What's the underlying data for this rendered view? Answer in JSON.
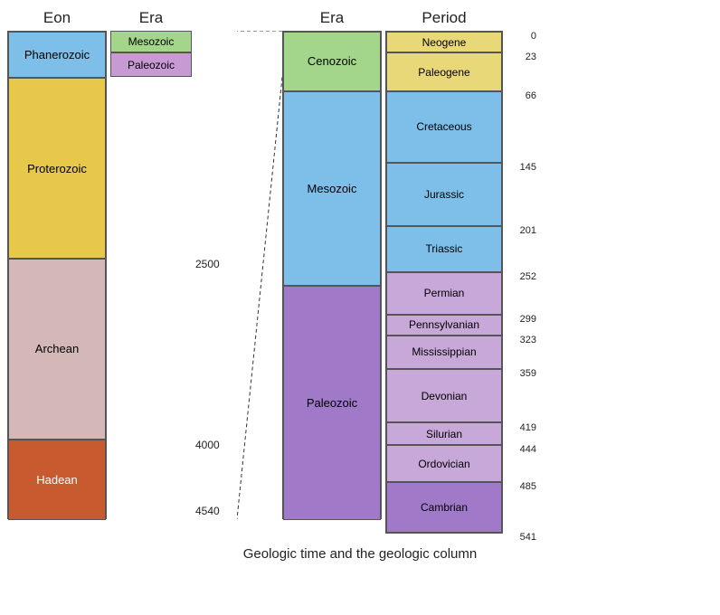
{
  "title": "Geologic time and the geologic column",
  "headers": {
    "eon": "Eon",
    "era_left": "Era",
    "era_right": "Era",
    "period": "Period"
  },
  "eons": [
    {
      "name": "Phanerozoic",
      "class": "cell-phanerozoic",
      "height_pct": 9.5
    },
    {
      "name": "Proterozoic",
      "class": "cell-proterozoic",
      "height_pct": 37
    },
    {
      "name": "Archean",
      "class": "cell-archean",
      "height_pct": 37
    },
    {
      "name": "Hadean",
      "class": "cell-hadean",
      "height_pct": 16.5
    }
  ],
  "eras_left": [
    {
      "name": "Mesozoic",
      "class": "cell-mesozoic-left",
      "height_pct": 4.5
    },
    {
      "name": "Paleozoic",
      "class": "cell-paleozoic-left",
      "height_pct": 5
    }
  ],
  "eras_right": [
    {
      "name": "Cenozoic",
      "class": "cell-cenozoic",
      "height_pct": 12.2
    },
    {
      "name": "Mesozoic",
      "class": "cell-mesozoic",
      "height_pct": 39.8
    },
    {
      "name": "Paleozoic",
      "class": "cell-paleozoic",
      "height_pct": 48
    }
  ],
  "periods": [
    {
      "name": "Neogene",
      "class": "cell-neogene",
      "height_pct": 4.3,
      "age_top": "0"
    },
    {
      "name": "Paleogene",
      "class": "cell-paleogene",
      "height_pct": 7.9,
      "age_top": "23"
    },
    {
      "name": "Cretaceous",
      "class": "cell-cretaceous",
      "height_pct": 14.6,
      "age_top": "66"
    },
    {
      "name": "Jurassic",
      "class": "cell-jurassic",
      "height_pct": 13.0,
      "age_top": "145"
    },
    {
      "name": "Triassic",
      "class": "cell-triassic",
      "height_pct": 9.4,
      "age_top": "201"
    },
    {
      "name": "Permian",
      "class": "cell-permian",
      "height_pct": 8.7,
      "age_top": "252"
    },
    {
      "name": "Pennsylvanian",
      "class": "cell-pennsylvanian",
      "height_pct": 4.4,
      "age_top": "299"
    },
    {
      "name": "Mississippian",
      "class": "cell-mississippian",
      "height_pct": 6.7,
      "age_top": "323"
    },
    {
      "name": "Devonian",
      "class": "cell-devonian",
      "height_pct": 11.1,
      "age_top": "359"
    },
    {
      "name": "Silurian",
      "class": "cell-silurian",
      "height_pct": 4.6,
      "age_top": "419"
    },
    {
      "name": "Ordovician",
      "class": "cell-ordovician",
      "height_pct": 7.6,
      "age_top": "444"
    },
    {
      "name": "Cambrian",
      "class": "cell-cambrian",
      "height_pct": 10.3,
      "age_top": "485"
    }
  ],
  "period_ages": [
    "0",
    "23",
    "66",
    "145",
    "201",
    "252",
    "299",
    "323",
    "359",
    "419",
    "444",
    "485",
    "541"
  ],
  "mid_labels": [
    {
      "value": "2500",
      "top_pct": 46.5
    },
    {
      "value": "4000",
      "top_pct": 83.5
    },
    {
      "value": "4540",
      "top_pct": 97
    }
  ]
}
